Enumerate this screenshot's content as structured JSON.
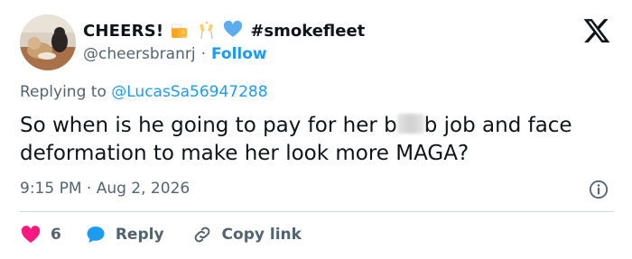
{
  "author": {
    "name": "CHEERS!",
    "handle": "@cheersbranrj",
    "separator": "·",
    "follow_label": "Follow",
    "hashtag": "#smokefleet",
    "name_emojis": [
      "beer-mugs-emoji",
      "champagne-glasses-emoji",
      "blue-heart-emoji"
    ]
  },
  "reply_context": {
    "prefix": "Replying to",
    "mention": "@LucasSa56947288"
  },
  "tweet": {
    "text_part1": "So when is he going to pay for her b",
    "text_part2": "b job and face deformation to make her look more MAGA?",
    "censored_icon": "blurred-word"
  },
  "meta": {
    "timestamp": "9:15 PM · Aug 2, 2026"
  },
  "actions": {
    "like_count": "6",
    "reply_label": "Reply",
    "copy_link_label": "Copy link"
  },
  "colors": {
    "text": "#0f1419",
    "secondary": "#536471",
    "link": "#1d9bf0",
    "like_red": "#f91880",
    "divider": "#cfd9de"
  },
  "icons": {
    "brand": "x-logo-icon",
    "info": "info-icon",
    "like": "heart-icon",
    "reply": "speech-bubble-icon",
    "copy_link": "link-icon"
  }
}
